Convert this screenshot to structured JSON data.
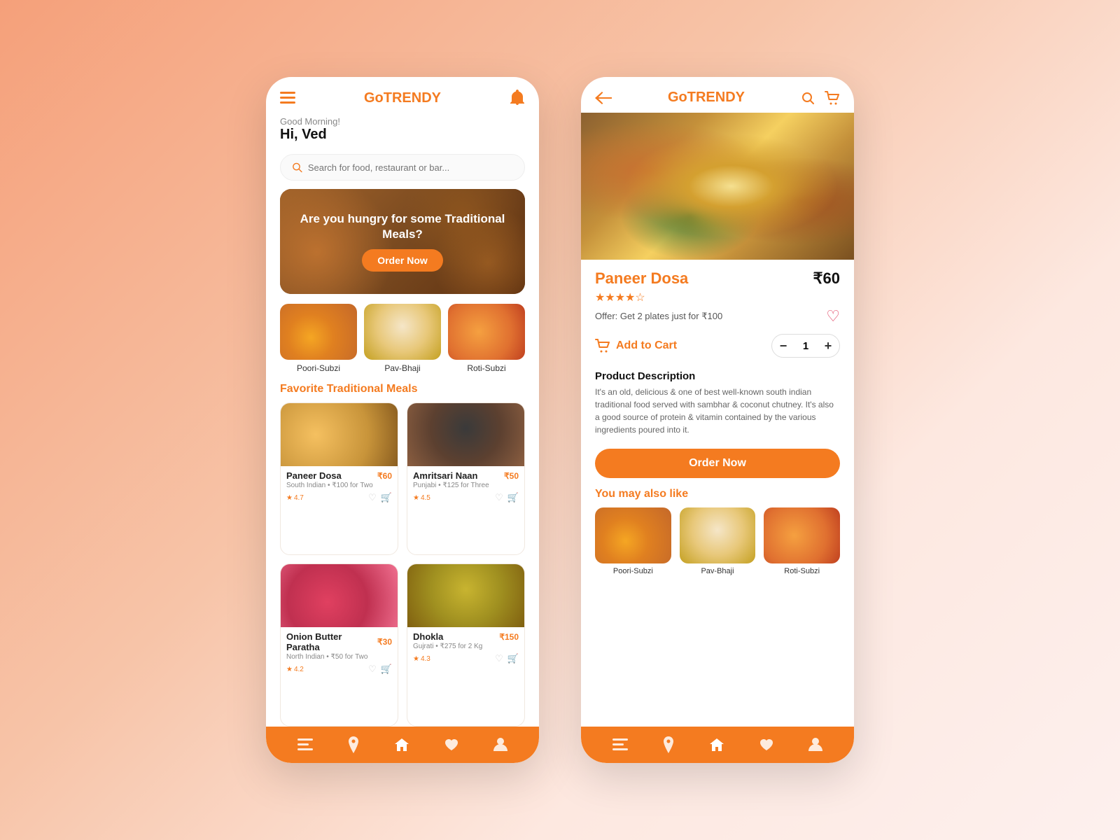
{
  "app": {
    "name_prefix": "Go",
    "name_brand": "TRENDY"
  },
  "left_phone": {
    "greeting_sub": "Good Morning!",
    "greeting_main": "Hi, Ved",
    "search_placeholder": "Search for food, restaurant or bar...",
    "banner": {
      "text": "Are you hungry for some Traditional Meals?",
      "cta": "Order Now"
    },
    "categories": [
      {
        "label": "Poori-Subzi"
      },
      {
        "label": "Pav-Bhaji"
      },
      {
        "label": "Roti-Subzi"
      }
    ],
    "section_title": "Favorite Traditional Meals",
    "meals": [
      {
        "name": "Paneer Dosa",
        "price": "₹60",
        "sub": "South Indian",
        "offer": "₹100 for Two",
        "rating": "4.7"
      },
      {
        "name": "Amritsari Naan",
        "price": "₹50",
        "sub": "Punjabi",
        "offer": "₹125 for Three",
        "rating": "4.5"
      },
      {
        "name": "Onion Butter Paratha",
        "price": "₹30",
        "sub": "North Indian",
        "offer": "₹50 for Two",
        "rating": "4.2"
      },
      {
        "name": "Dhokla",
        "price": "₹150",
        "sub": "Gujrati",
        "offer": "₹275 for 2 Kg",
        "rating": "4.3"
      }
    ],
    "nav": [
      "menu",
      "location",
      "home",
      "heart",
      "person"
    ]
  },
  "right_phone": {
    "product": {
      "name": "Paneer Dosa",
      "price": "₹60",
      "stars": 4,
      "offer": "Offer: Get 2 plates just for ₹100",
      "add_to_cart": "Add to Cart",
      "quantity": 1,
      "desc_title": "Product Description",
      "desc_body": "It's an old, delicious & one of best well-known south indian traditional food served with sambhar & coconut chutney.  It's also a good source of protein & vitamin contained by the various ingredients poured into it.",
      "order_btn": "Order Now"
    },
    "you_may_like": {
      "title": "You may also like",
      "items": [
        {
          "label": "Poori-Subzi"
        },
        {
          "label": "Pav-Bhaji"
        },
        {
          "label": "Roti-Subzi"
        }
      ]
    },
    "nav": [
      "menu",
      "location",
      "home",
      "heart",
      "person"
    ]
  }
}
